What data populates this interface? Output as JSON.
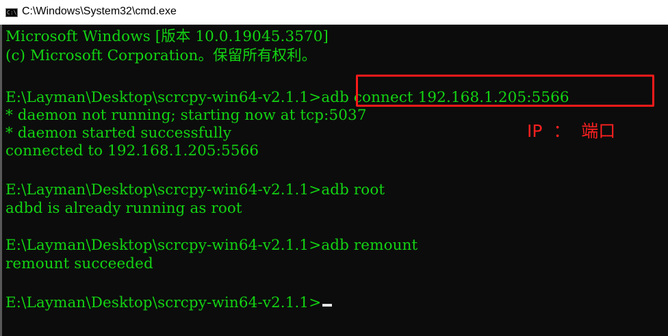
{
  "window": {
    "title": "C:\\Windows\\System32\\cmd.exe",
    "icon": "cmd-console-icon",
    "icon_text": "C:\\"
  },
  "console": {
    "text_color": "#13d313",
    "background": "#0c0c0c",
    "lines": [
      "Microsoft Windows [版本 10.0.19045.3570]",
      "(c) Microsoft Corporation。保留所有权利。",
      "",
      "E:\\Layman\\Desktop\\scrcpy-win64-v2.1.1>adb connect 192.168.1.205:5566",
      "* daemon not running; starting now at tcp:5037",
      "* daemon started successfully",
      "connected to 192.168.1.205:5566",
      "",
      "E:\\Layman\\Desktop\\scrcpy-win64-v2.1.1>adb root",
      "adbd is already running as root",
      "",
      "E:\\Layman\\Desktop\\scrcpy-win64-v2.1.1>adb remount",
      "remount succeeded",
      "",
      "E:\\Layman\\Desktop\\scrcpy-win64-v2.1.1>"
    ]
  },
  "annotation": {
    "label": "IP  ：  端口",
    "color": "#ff2020"
  }
}
